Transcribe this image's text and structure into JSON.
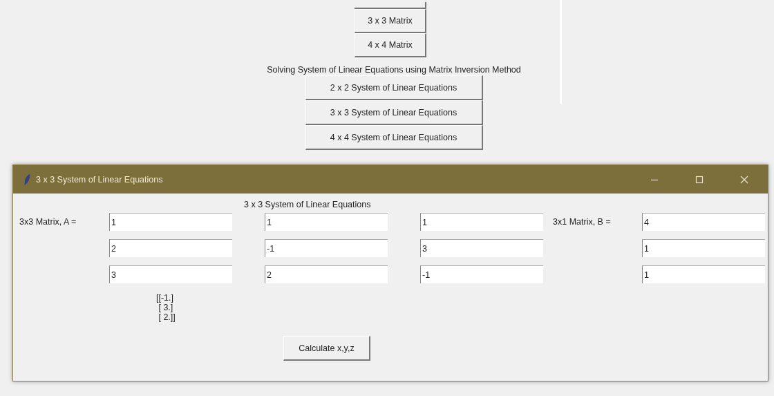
{
  "main_window": {
    "matrix_buttons": [
      "3 x 3 Matrix",
      "4 x 4 Matrix"
    ],
    "section_label": "Solving System of Linear Equations using Matrix Inversion Method",
    "system_buttons": [
      "2 x 2 System of Linear Equations",
      "3 x 3 System of Linear Equations",
      "4 x 4 System of Linear Equations"
    ]
  },
  "dialog": {
    "title": "3 x 3 System of Linear Equations",
    "heading": "3 x 3 System of Linear Equations",
    "matrix_a_label": "3x3 Matrix, A =",
    "matrix_a": [
      [
        "1",
        "1",
        "1"
      ],
      [
        "2",
        "-1",
        "3"
      ],
      [
        "3",
        "2",
        "-1"
      ]
    ],
    "matrix_b_label": "3x1 Matrix, B =",
    "matrix_b": [
      "4",
      "1",
      "1"
    ],
    "result": [
      "[[-1.]",
      " [ 3.]",
      " [ 2.]]"
    ],
    "calculate_button": "Calculate x,y,z"
  }
}
